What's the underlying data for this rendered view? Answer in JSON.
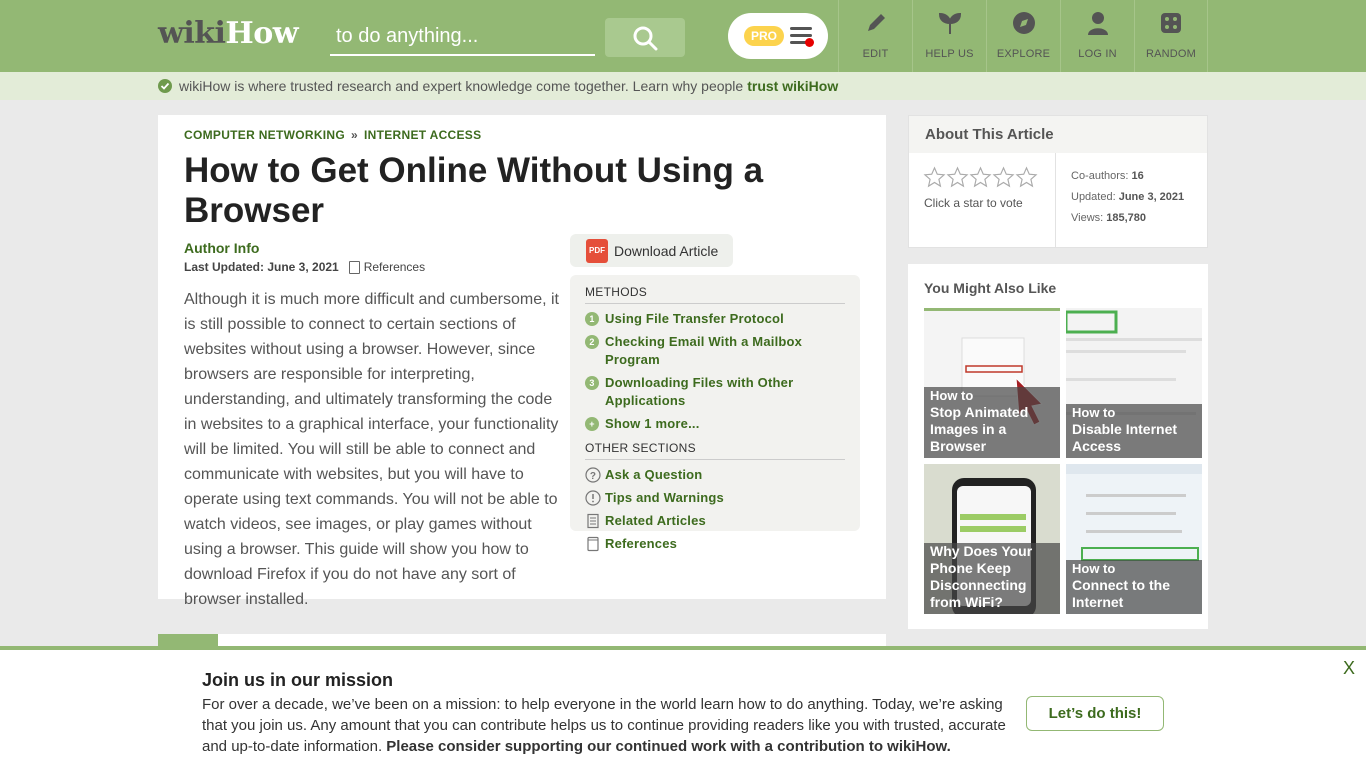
{
  "header": {
    "logo_wiki": "wiki",
    "logo_how": "How",
    "search_placeholder": "to do anything...",
    "pro_label": "PRO",
    "nav": [
      {
        "label": "EDIT",
        "icon": "pencil-icon"
      },
      {
        "label": "HELP US",
        "icon": "sprout-icon"
      },
      {
        "label": "EXPLORE",
        "icon": "compass-icon"
      },
      {
        "label": "LOG IN",
        "icon": "user-icon"
      },
      {
        "label": "RANDOM",
        "icon": "dice-icon"
      }
    ]
  },
  "trust_bar": {
    "text": "wikiHow is where trusted research and expert knowledge come together. Learn why people",
    "link": "trust wikiHow"
  },
  "article": {
    "breadcrumb": [
      "COMPUTER NETWORKING",
      "»",
      "INTERNET ACCESS"
    ],
    "title": "How to Get Online Without Using a Browser",
    "author_label": "Author Info",
    "updated_label": "Last Updated: June 3, 2021",
    "references_label": "References",
    "intro": "Although it is much more difficult and cumbersome, it is still possible to connect to certain sections of websites without using a browser. However, since browsers are responsible for interpreting, understanding, and ultimately transforming the code in websites to a graphical interface, your functionality will be limited. You will still be able to connect and communicate with websites, but you will have to operate using text commands. You will not be able to watch videos, see images, or play games without using a browser. This guide will show you how to download Firefox if you do not have any sort of browser installed.",
    "download_label": "Download Article",
    "pdf_label": "PDF"
  },
  "toc": {
    "methods_heading": "METHODS",
    "methods": [
      {
        "num": "1",
        "label": "Using File Transfer Protocol"
      },
      {
        "num": "2",
        "label": "Checking Email With a Mailbox Program"
      },
      {
        "num": "3",
        "label": "Downloading Files with Other Applications"
      }
    ],
    "show_more": {
      "num": "+",
      "label": "Show 1 more..."
    },
    "other_heading": "OTHER SECTIONS",
    "other": [
      {
        "label": "Ask a Question",
        "icon": "question-icon"
      },
      {
        "label": "Tips and Warnings",
        "icon": "exclamation-icon"
      },
      {
        "label": "Related Articles",
        "icon": "document-icon"
      },
      {
        "label": "References",
        "icon": "book-icon"
      }
    ]
  },
  "about": {
    "heading": "About This Article",
    "vote_label": "Click a star to vote",
    "stars_filled": 0,
    "coauthors_label": "Co-authors:",
    "coauthors_value": "16",
    "updated_label": "Updated:",
    "updated_value": "June 3, 2021",
    "views_label": "Views:",
    "views_value": "185,780"
  },
  "also": {
    "heading": "You Might Also Like",
    "tiles": [
      {
        "small": "How to",
        "title": "Stop Animated Images in a Browser"
      },
      {
        "small": "How to",
        "title": "Disable Internet Access"
      },
      {
        "small": "",
        "title": "Why Does Your Phone Keep Disconnecting from WiFi?"
      },
      {
        "small": "How to",
        "title": "Connect to the Internet"
      }
    ]
  },
  "banner": {
    "title": "Join us in our mission",
    "text": "For over a decade, we’ve been on a mission: to help everyone in the world learn how to do anything. Today, we’re asking that you join us. Any amount that you can contribute helps us to continue providing readers like you with trusted, accurate and up-to-date information.",
    "text_bold": "Please consider supporting our continued work with a contribution to wikiHow.",
    "button": "Let’s do this!",
    "close": "X"
  },
  "colors": {
    "brand_green": "#93b874",
    "link_green": "#3d6b1e",
    "pro_yellow": "#fcd34d"
  }
}
